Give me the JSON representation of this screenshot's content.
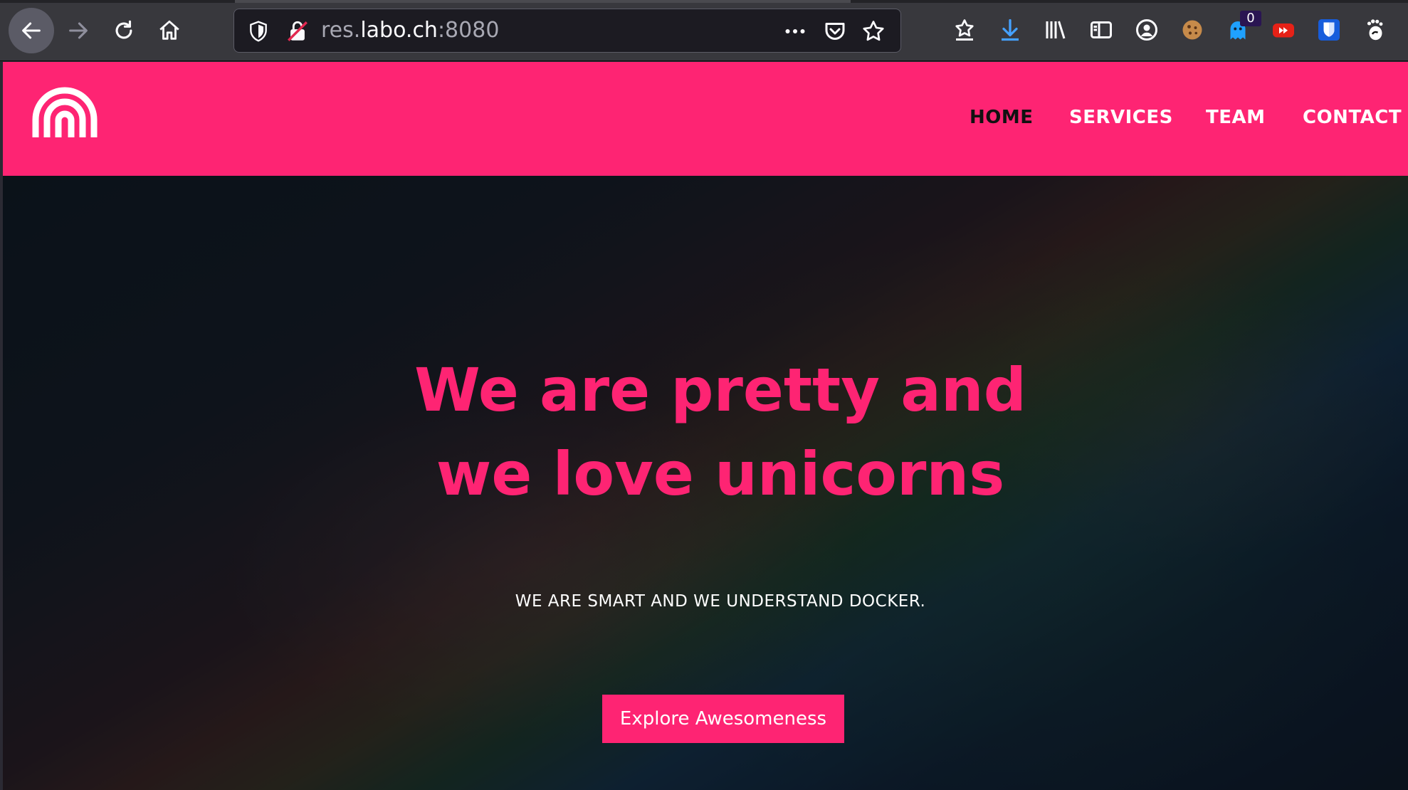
{
  "browser": {
    "url_prefix": "res.",
    "url_domain": "labo.ch",
    "url_port": ":8080",
    "extension_badge": "0"
  },
  "site": {
    "nav": [
      "HOME",
      "SERVICES",
      "TEAM",
      "CONTACT"
    ],
    "active_nav": "HOME",
    "brand_color": "#fe2473"
  },
  "hero": {
    "title_line1": "We are pretty and",
    "title_line2": "we love unicorns",
    "subtitle": "WE ARE SMART AND WE UNDERSTAND DOCKER.",
    "cta_label": "Explore Awesomeness"
  }
}
